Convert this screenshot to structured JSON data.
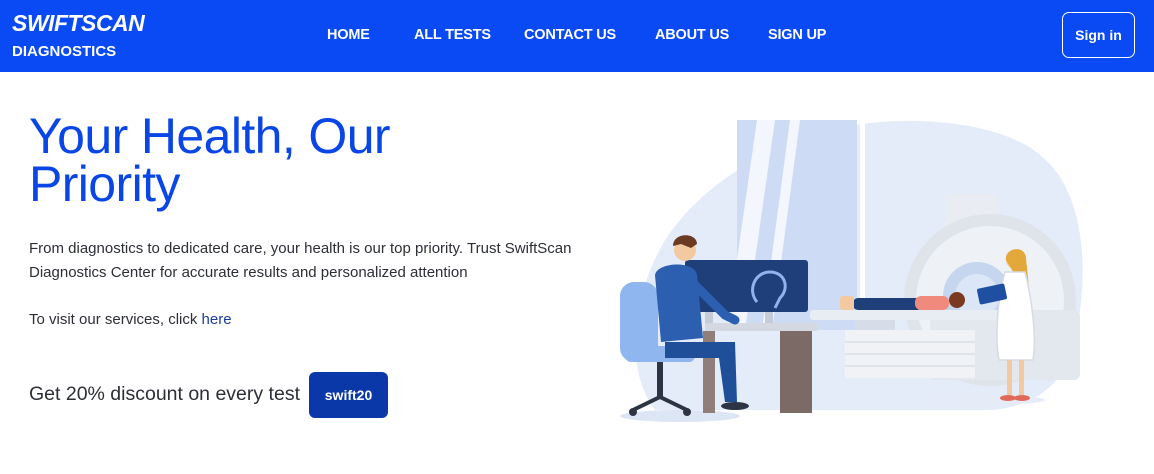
{
  "brand": {
    "name": "SWIFTSCAN",
    "subtitle": "DIAGNOSTICS"
  },
  "nav": {
    "items": [
      "HOME",
      "ALL TESTS",
      "CONTACT US",
      "ABOUT US",
      "SIGN UP"
    ]
  },
  "header": {
    "signin_label": "Sign in"
  },
  "hero": {
    "title_line1": "Your Health, Our",
    "title_line2": "Priority",
    "description": "From diagnostics to dedicated care, your health is our top priority. Trust SwiftScan Diagnostics Center for accurate results and personalized attention",
    "visit_prefix": "To visit our services, click ",
    "visit_link": "here",
    "discount_text": "Get 20% discount on every test",
    "discount_code": "swift20"
  },
  "colors": {
    "brand_blue": "#0a4af5",
    "title_blue": "#0a45e6",
    "code_button": "#0b38a8",
    "link": "#1c3d9e"
  }
}
